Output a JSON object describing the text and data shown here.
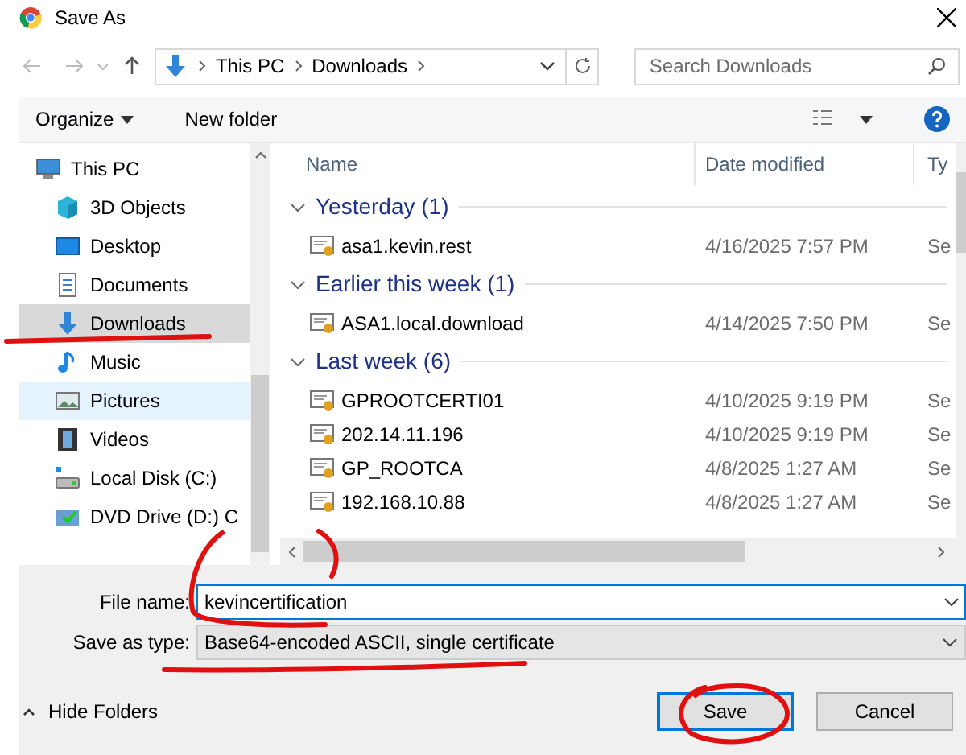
{
  "window": {
    "title": "Save As"
  },
  "address_bar": {
    "crumbs": [
      "This PC",
      "Downloads"
    ]
  },
  "search": {
    "placeholder": "Search Downloads"
  },
  "toolbar": {
    "organize": "Organize",
    "new_folder": "New folder"
  },
  "sidebar": {
    "items": [
      {
        "label": "This PC",
        "kind": "pc",
        "selected": false,
        "hovered": false,
        "children": [
          {
            "label": "3D Objects",
            "kind": "cube",
            "selected": false,
            "hovered": false
          },
          {
            "label": "Desktop",
            "kind": "desktop",
            "selected": false,
            "hovered": false
          },
          {
            "label": "Documents",
            "kind": "doc",
            "selected": false,
            "hovered": false
          },
          {
            "label": "Downloads",
            "kind": "download",
            "selected": true,
            "hovered": false
          },
          {
            "label": "Music",
            "kind": "music",
            "selected": false,
            "hovered": false
          },
          {
            "label": "Pictures",
            "kind": "pictures",
            "selected": false,
            "hovered": true
          },
          {
            "label": "Videos",
            "kind": "videos",
            "selected": false,
            "hovered": false
          },
          {
            "label": "Local Disk (C:)",
            "kind": "disk",
            "selected": false,
            "hovered": false
          },
          {
            "label": "DVD Drive (D:) C",
            "kind": "dvd",
            "selected": false,
            "hovered": false
          }
        ]
      }
    ]
  },
  "table": {
    "columns": [
      "Name",
      "Date modified",
      "Ty"
    ],
    "groups": [
      {
        "title": "Yesterday (1)",
        "expanded": true,
        "rows": [
          {
            "name": "asa1.kevin.rest",
            "date": "4/16/2025 7:57 PM",
            "type": "Se"
          }
        ]
      },
      {
        "title": "Earlier this week (1)",
        "expanded": true,
        "rows": [
          {
            "name": "ASA1.local.download",
            "date": "4/14/2025 7:50 PM",
            "type": "Se"
          }
        ]
      },
      {
        "title": "Last week (6)",
        "expanded": true,
        "rows": [
          {
            "name": "GPROOTCERTI01",
            "date": "4/10/2025 9:19 PM",
            "type": "Se"
          },
          {
            "name": "202.14.11.196",
            "date": "4/10/2025 9:19 PM",
            "type": "Se"
          },
          {
            "name": "GP_ROOTCA",
            "date": "4/8/2025 1:27 AM",
            "type": "Se"
          },
          {
            "name": "192.168.10.88",
            "date": "4/8/2025 1:27 AM",
            "type": "Se"
          }
        ]
      }
    ]
  },
  "form": {
    "file_name_label": "File name:",
    "file_name": "kevincertification",
    "type_label": "Save as type:",
    "type_value": "Base64-encoded ASCII, single certificate"
  },
  "footer": {
    "hide_folders": "Hide Folders",
    "save": "Save",
    "cancel": "Cancel"
  }
}
